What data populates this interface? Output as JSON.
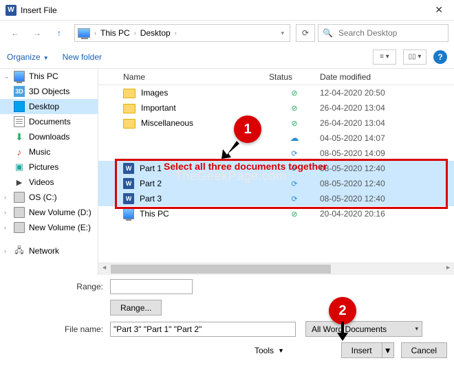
{
  "window": {
    "title": "Insert File"
  },
  "breadcrumb": {
    "pc": "This PC",
    "loc": "Desktop"
  },
  "search": {
    "placeholder": "Search Desktop"
  },
  "toolbar": {
    "organize": "Organize",
    "newfolder": "New folder"
  },
  "nav": {
    "thispc": "This PC",
    "objects3d": "3D Objects",
    "desktop": "Desktop",
    "documents": "Documents",
    "downloads": "Downloads",
    "music": "Music",
    "pictures": "Pictures",
    "videos": "Videos",
    "osc": "OS (C:)",
    "volD": "New Volume (D:)",
    "volE": "New Volume (E:)",
    "network": "Network"
  },
  "columns": {
    "name": "Name",
    "status": "Status",
    "date": "Date modified"
  },
  "rows": [
    {
      "type": "folder",
      "name": "Images",
      "status": "ok",
      "date": "12-04-2020 20:50",
      "sel": false
    },
    {
      "type": "folder",
      "name": "Important",
      "status": "ok",
      "date": "26-04-2020 13:04",
      "sel": false
    },
    {
      "type": "folder",
      "name": "Miscellaneous",
      "status": "ok",
      "date": "26-04-2020 13:04",
      "sel": false
    },
    {
      "type": "cloud",
      "name": "",
      "status": "cloud",
      "date": "04-05-2020 14:07",
      "sel": false
    },
    {
      "type": "sync",
      "name": "",
      "status": "sync",
      "date": "08-05-2020 14:09",
      "sel": false
    },
    {
      "type": "word",
      "name": "Part 1",
      "status": "sync",
      "date": "08-05-2020 12:40",
      "sel": true
    },
    {
      "type": "word",
      "name": "Part 2",
      "status": "sync",
      "date": "08-05-2020 12:40",
      "sel": true
    },
    {
      "type": "word",
      "name": "Part 3",
      "status": "sync",
      "date": "08-05-2020 12:40",
      "sel": true
    },
    {
      "type": "pc",
      "name": "This PC",
      "status": "ok",
      "date": "20-04-2020 20:16",
      "sel": false
    }
  ],
  "range": {
    "label": "Range:",
    "button": "Range..."
  },
  "filename": {
    "label": "File name:",
    "value": "\"Part 3\" \"Part 1\" \"Part 2\""
  },
  "filter": {
    "value": "All Word Documents"
  },
  "tools": "Tools",
  "insert": "Insert",
  "cancel": "Cancel",
  "annot": {
    "n1": "1",
    "n2": "2",
    "text": "Select all three documents together"
  },
  "watermark": "TheGeekPage.com"
}
